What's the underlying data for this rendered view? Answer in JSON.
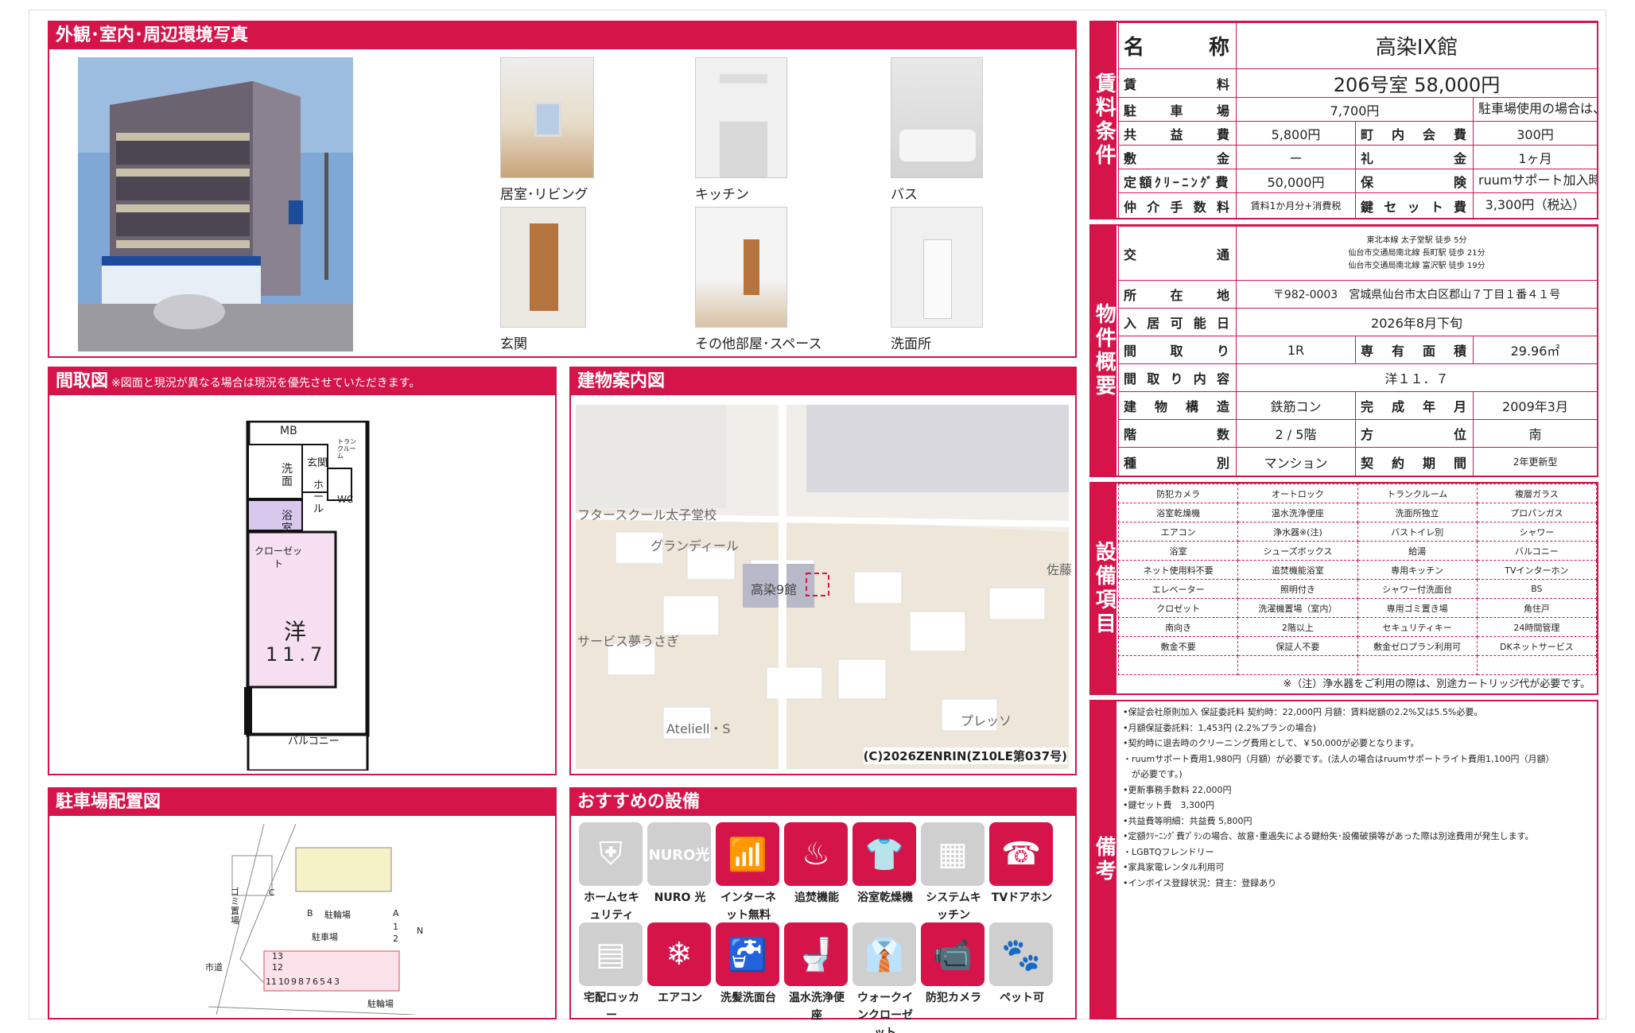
{
  "photos": {
    "header": "外観･室内･周辺環境写真",
    "captions": [
      "居室･リビング",
      "キッチン",
      "バス",
      "玄関",
      "その他部屋･スペース",
      "洗面所"
    ]
  },
  "floorplan": {
    "header": "間取図",
    "note": "※図面と現況が異なる場合は現況を優先させていただきます。",
    "labels": {
      "mb": "MB",
      "sentaku": "洗面",
      "yokushitsu": "浴室",
      "genkan": "玄関",
      "hall": "ホール",
      "wc": "WC",
      "closet": "クローゼット",
      "trunk": "トランクルーム",
      "room": "洋",
      "size": "11.7",
      "balcony": "バルコニー"
    }
  },
  "map": {
    "header": "建物案内図",
    "labels": [
      "フタースクール太子堂校",
      "グランディール",
      "高染9館",
      "サービス夢うさぎ",
      "Ateliell・S",
      "プレッソ",
      "佐藤"
    ],
    "copyright": "(C)2026ZENRIN(Z10LE第037号)"
  },
  "parking": {
    "header": "駐車場配置図",
    "labels": {
      "gomi": "ゴミ置場",
      "cycle1": "駐輪場",
      "parking": "駐車場",
      "road": "市道",
      "cycle2": "駐輪場",
      "c": "C",
      "b": "B",
      "a": "A",
      "n": "N"
    },
    "slots": [
      "11",
      "10",
      "9",
      "8",
      "7",
      "6",
      "5",
      "4",
      "3"
    ],
    "slots_side": [
      "13",
      "12"
    ],
    "slots_right": [
      "1",
      "2"
    ]
  },
  "recommended": {
    "header": "おすすめの設備",
    "items": [
      {
        "label": "ホームセキュリティ",
        "on": false,
        "icon": "shield-icon"
      },
      {
        "label": "NURO 光",
        "on": false,
        "icon": "nuro-icon",
        "text": "NURO光"
      },
      {
        "label": "インターネット無料",
        "on": true,
        "icon": "wifi-icon"
      },
      {
        "label": "追焚機能",
        "on": true,
        "icon": "bathtub-icon"
      },
      {
        "label": "浴室乾燥機",
        "on": true,
        "icon": "bath-dryer-icon"
      },
      {
        "label": "システムキッチン",
        "on": false,
        "icon": "kitchen-icon"
      },
      {
        "label": "TVドアホン",
        "on": true,
        "icon": "intercom-icon"
      },
      {
        "label": "宅配ロッカー",
        "on": false,
        "icon": "locker-icon"
      },
      {
        "label": "エアコン",
        "on": true,
        "icon": "aircon-icon"
      },
      {
        "label": "洗髪洗面台",
        "on": true,
        "icon": "washbasin-icon"
      },
      {
        "label": "温水洗浄便座",
        "on": true,
        "icon": "toilet-icon"
      },
      {
        "label": "ウォークインクローゼット",
        "on": false,
        "icon": "closet-icon"
      },
      {
        "label": "防犯カメラ",
        "on": true,
        "icon": "camera-icon"
      },
      {
        "label": "ペット可",
        "on": false,
        "icon": "paw-icon"
      }
    ]
  },
  "rent": {
    "vlabel": "賃料条件",
    "name_label": "名　称",
    "name": "高染IX館",
    "rent_label": "賃料",
    "rent": "206号室 58,000円",
    "parking_label": "駐車場",
    "parking": "7,700円",
    "parking_note": "駐車場使用の場合は、別途手数料（駐車料+消費税）が必要です。",
    "common_label": "共益費",
    "common": "5,800円",
    "town_label": "町内会費",
    "town": "300円",
    "deposit_label": "敷金",
    "deposit": "ー",
    "key_label": "礼金",
    "key": "1ヶ月",
    "clean_label": "定額ｸﾘｰﾆﾝｸﾞ費",
    "clean": "50,000円",
    "ins_label": "保険",
    "ins": "ruumサポート加入時は不要",
    "fee_label": "仲介手数料",
    "fee": "賃料1か月分+消費税",
    "keyset_label": "鍵セット費",
    "keyset": "3,300円（税込）"
  },
  "summary": {
    "vlabel": "物件概要",
    "traffic_label": "交通",
    "traffic": [
      "東北本線 太子堂駅 徒歩 5分",
      "仙台市交通局南北線 長町駅 徒歩 21分",
      "仙台市交通局南北線 富沢駅 徒歩 19分"
    ],
    "addr_label": "所在地",
    "addr": "〒982-0003　宮城県仙台市太白区郡山７丁目１番４１号",
    "move_label": "入居可能日",
    "move": "2026年8月下旬",
    "layout_label": "間取り",
    "layout": "1R",
    "area_label": "専有面積",
    "area": "29.96㎡",
    "detail_label": "間取り内容",
    "detail": "洋１１．７",
    "struct_label": "建物構造",
    "struct": "鉄筋コン",
    "built_label": "完成年月",
    "built": "2009年3月",
    "floor_label": "階数",
    "floor": "2 / 5階",
    "dir_label": "方位",
    "dir": "南",
    "type_label": "種別",
    "type": "マンション",
    "contract_label": "契約期間",
    "contract": "2年更新型"
  },
  "equipment": {
    "vlabel": "設備項目",
    "rows": [
      [
        "防犯カメラ",
        "オートロック",
        "トランクルーム",
        "複層ガラス"
      ],
      [
        "浴室乾燥機",
        "温水洗浄便座",
        "洗面所独立",
        "プロパンガス"
      ],
      [
        "エアコン",
        "浄水器※(注)",
        "バストイレ別",
        "シャワー"
      ],
      [
        "浴室",
        "シューズボックス",
        "給湯",
        "バルコニー"
      ],
      [
        "ネット使用料不要",
        "追焚機能浴室",
        "専用キッチン",
        "TVインターホン"
      ],
      [
        "エレベーター",
        "照明付き",
        "シャワー付洗面台",
        "BS"
      ],
      [
        "クロゼット",
        "洗濯機置場（室内）",
        "専用ゴミ置き場",
        "角住戸"
      ],
      [
        "南向き",
        "2階以上",
        "セキュリティキー",
        "24時間管理"
      ],
      [
        "敷金不要",
        "保証人不要",
        "敷金ゼロプラン利用可",
        "DKネットサービス"
      ],
      [
        "",
        "",
        "",
        ""
      ]
    ],
    "note": "※（注）浄水器をご利用の際は、別途カートリッジ代が必要です。"
  },
  "remarks": {
    "vlabel": "備考",
    "lines": [
      "•保証会社原則加入 保証委託料 契約時：22,000円 月額：賃料総額の2.2%又は5.5%必要。",
      "•月額保証委託料：1,453円 (2.2%プランの場合)",
      "•契約時に退去時のクリーニング費用として、￥50,000が必要となります。",
      "・ruumサポート費用1,980円（月額）が必要です。(法人の場合はruumサポートライト費用1,100円（月額）",
      "　が必要です。)",
      "•更新事務手数料 22,000円",
      "•鍵セット費　3,300円",
      "•共益費等明細：共益費 5,800円",
      "•定額ｸﾘｰﾆﾝｸﾞ費ﾌﾟﾗﾝの場合、故意･重過失による鍵紛失･設備破損等があった際は別途費用が発生します。",
      "・LGBTQフレンドリー",
      "•家具家電レンタル利用可",
      "•インボイス登録状況：貸主：登録あり"
    ]
  }
}
